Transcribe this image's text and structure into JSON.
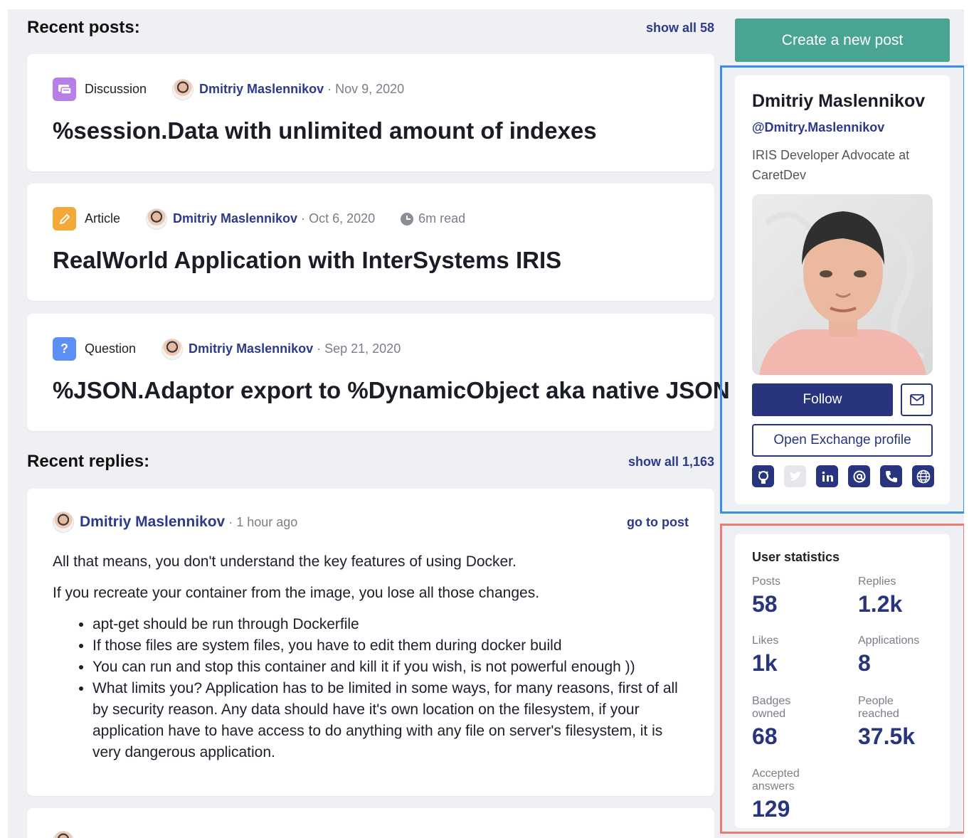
{
  "recent_posts": {
    "title": "Recent posts:",
    "show_all": "show all 58",
    "items": [
      {
        "type": "Discussion",
        "author": "Dmitriy Maslennikov",
        "date": "· Nov 9, 2020",
        "title": "%session.Data with unlimited amount of indexes",
        "icon_color": "#b67fe8"
      },
      {
        "type": "Article",
        "author": "Dmitriy Maslennikov",
        "date": "· Oct 6, 2020",
        "read_time": "6m read",
        "title": "RealWorld Application with InterSystems IRIS",
        "icon_color": "#f2a93a"
      },
      {
        "type": "Question",
        "author": "Dmitriy Maslennikov",
        "date": "· Sep 21, 2020",
        "title": "%JSON.Adaptor export to %DynamicObject aka native JSON",
        "icon_color": "#5b8ff5",
        "icon_glyph": "?"
      }
    ]
  },
  "recent_replies": {
    "title": "Recent replies:",
    "show_all": "show all 1,163",
    "items": [
      {
        "author": "Dmitriy Maslennikov",
        "time": "· 1 hour ago",
        "go_to_post": "go to post",
        "paragraphs": [
          "All that means, you don't understand the key features of using Docker.",
          "If you recreate your container from the image, you lose all those changes."
        ],
        "bullets": [
          "apt-get should be run through Dockerfile",
          "If those files are system files, you have to edit them during docker build",
          "You can run and stop this container and kill it if you wish, is not powerful enough ))",
          "What limits you? Application has to be limited in some ways, for many reasons, first of all by security reason. Any data should have it's own location on the filesystem, if your application have to have access to do anything with any file on server's filesystem, it is very dangerous application."
        ]
      }
    ]
  },
  "sidebar": {
    "create_post": "Create a new post",
    "profile": {
      "name": "Dmitriy Maslennikov",
      "handle": "@Dmitry.Maslennikov",
      "role": "IRIS Developer Advocate at CaretDev",
      "follow": "Follow",
      "open_exchange": "Open Exchange profile",
      "socials": [
        "github-icon",
        "twitter-icon",
        "linkedin-icon",
        "email-at-icon",
        "phone-icon",
        "globe-icon"
      ]
    },
    "stats": {
      "title": "User statistics",
      "posts_label": "Posts",
      "posts": "58",
      "replies_label": "Replies",
      "replies": "1.2k",
      "likes_label": "Likes",
      "likes": "1k",
      "applications_label": "Applications",
      "applications": "8",
      "badges_label": "Badges owned",
      "badges": "68",
      "people_label": "People reached",
      "people": "37.5k",
      "accepted_label": "Accepted answers",
      "accepted": "129"
    }
  },
  "colors": {
    "accent_blue": "#28347e",
    "create_button": "#4aa493",
    "highlight_blue": "#3b8ee8",
    "highlight_red": "#ea7e74"
  }
}
